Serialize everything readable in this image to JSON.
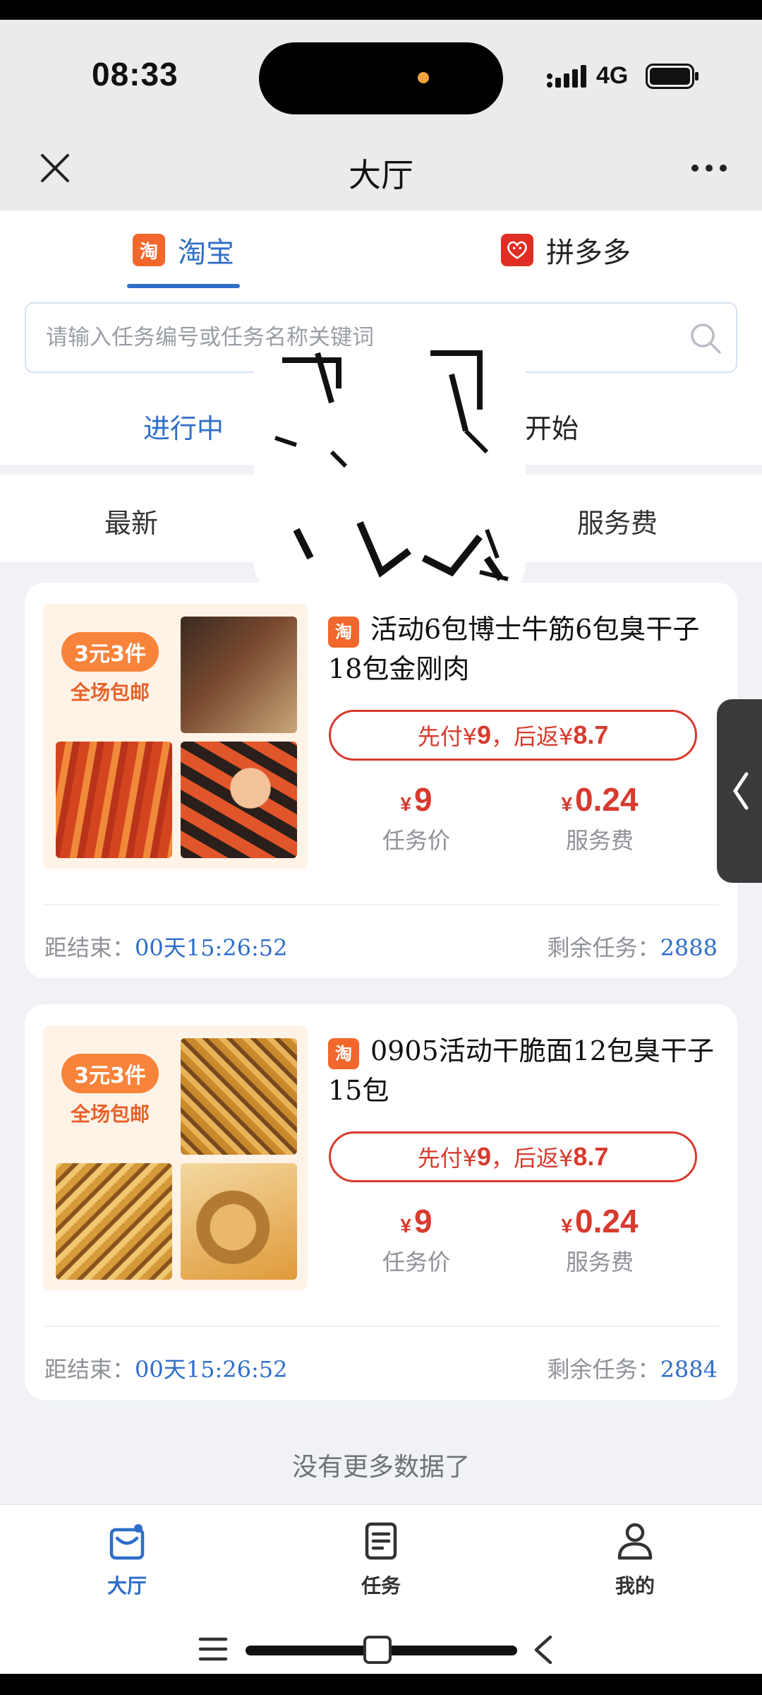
{
  "status_bar": {
    "time": "08:33",
    "network": "4G"
  },
  "nav": {
    "title": "大厅"
  },
  "platform_tabs": [
    {
      "label": "淘宝",
      "icon": "淘",
      "active": true
    },
    {
      "label": "拼多多",
      "active": false
    }
  ],
  "search": {
    "placeholder": "请输入任务编号或任务名称关键词"
  },
  "status_tabs": [
    {
      "label": "进行中",
      "active": true
    },
    {
      "label": "即将开始",
      "active": false
    }
  ],
  "sort_tabs": [
    {
      "label": "最新"
    },
    {
      "label": "服务费"
    }
  ],
  "tasks": [
    {
      "platform_tag": "淘",
      "title": "活动6包博士牛筋6包臭干子18包金刚肉",
      "promo_badge": "3元3件",
      "promo_sub": "全场包邮",
      "pay_prefix": "先付¥",
      "pay_first": "9",
      "pay_mid": "，后返¥",
      "pay_return": "8.7",
      "currency": "¥",
      "task_price": "9",
      "task_price_label": "任务价",
      "service_fee": "0.24",
      "service_fee_label": "服务费",
      "countdown_label": "距结束：",
      "countdown": "00天15:26:52",
      "remain_label": "剩余任务：",
      "remain": "2888"
    },
    {
      "platform_tag": "淘",
      "title": "0905活动干脆面12包臭干子15包",
      "promo_badge": "3元3件",
      "promo_sub": "全场包邮",
      "pay_prefix": "先付¥",
      "pay_first": "9",
      "pay_mid": "，后返¥",
      "pay_return": "8.7",
      "currency": "¥",
      "task_price": "9",
      "task_price_label": "任务价",
      "service_fee": "0.24",
      "service_fee_label": "服务费",
      "countdown_label": "距结束：",
      "countdown": "00天15:26:52",
      "remain_label": "剩余任务：",
      "remain": "2884"
    }
  ],
  "footer_text": "没有更多数据了",
  "bottom_nav": [
    {
      "label": "大厅",
      "icon": "hall-bag-icon",
      "active": true
    },
    {
      "label": "任务",
      "icon": "document-icon",
      "active": false
    },
    {
      "label": "我的",
      "icon": "person-icon",
      "active": false
    }
  ],
  "colors": {
    "accent": "#2f6ec8",
    "price_red": "#d83a2e",
    "taobao_orange": "#f2672c",
    "background": "#f0f2f6"
  }
}
